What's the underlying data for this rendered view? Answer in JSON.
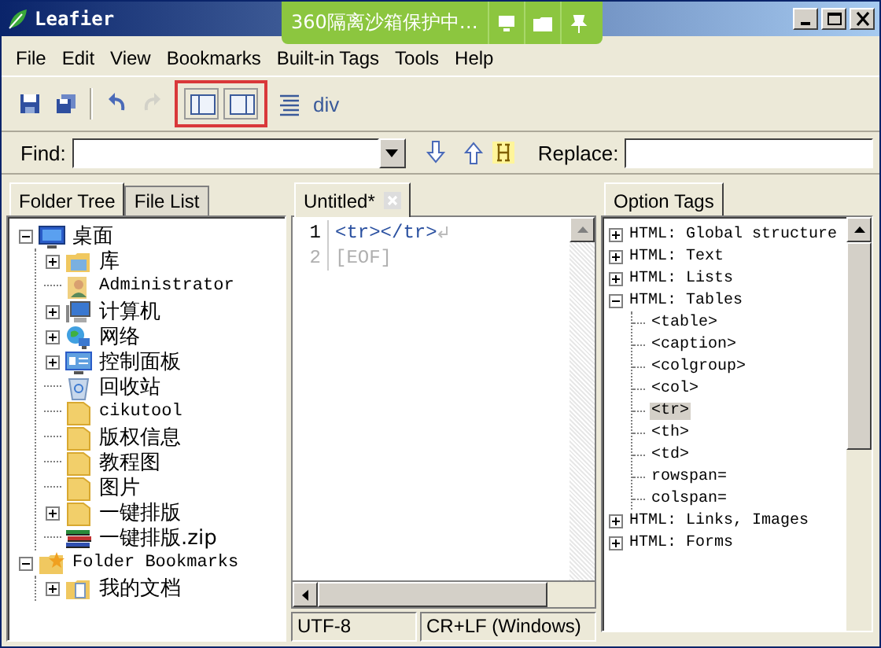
{
  "window": {
    "title": "Leafier"
  },
  "sandbox_bar": {
    "text": "360隔离沙箱保护中…"
  },
  "menu": [
    "File",
    "Edit",
    "View",
    "Bookmarks",
    "Built-in Tags",
    "Tools",
    "Help"
  ],
  "toolbar": {
    "groups": [
      {
        "highlighted": false,
        "buttons": [
          {
            "kind": "save",
            "disabled": false
          },
          {
            "kind": "save-all",
            "disabled": false
          }
        ]
      },
      {
        "highlighted": false,
        "buttons": [
          {
            "kind": "undo",
            "disabled": false
          },
          {
            "kind": "redo",
            "disabled": true
          }
        ]
      },
      {
        "highlighted": true,
        "buttons": [
          {
            "kind": "left-pane",
            "disabled": false
          },
          {
            "kind": "right-pane",
            "disabled": false
          }
        ]
      },
      {
        "highlighted": false,
        "buttons": [
          {
            "kind": "align",
            "disabled": false
          }
        ]
      }
    ],
    "tag_label": "div"
  },
  "find_bar": {
    "find_label": "Find:",
    "replace_label": "Replace:"
  },
  "left_panel": {
    "tabs": [
      {
        "label": "Folder Tree",
        "selected": true
      },
      {
        "label": "File List",
        "selected": false
      }
    ],
    "tree": [
      {
        "label": "桌面",
        "kind": "desktop",
        "expanded": true,
        "children": [
          {
            "label": "库",
            "kind": "library",
            "expanded": false
          },
          {
            "label": "Administrator",
            "kind": "user"
          },
          {
            "label": "计算机",
            "kind": "computer",
            "expanded": false
          },
          {
            "label": "网络",
            "kind": "network",
            "expanded": false
          },
          {
            "label": "控制面板",
            "kind": "control-panel",
            "expanded": false
          },
          {
            "label": "回收站",
            "kind": "recycle-bin"
          },
          {
            "label": "cikutool",
            "kind": "folder"
          },
          {
            "label": "版权信息",
            "kind": "folder"
          },
          {
            "label": "教程图",
            "kind": "folder"
          },
          {
            "label": "图片",
            "kind": "folder"
          },
          {
            "label": "一键排版",
            "kind": "folder",
            "expanded": false
          },
          {
            "label": "一键排版.zip",
            "kind": "archive"
          }
        ]
      },
      {
        "label": "Folder Bookmarks",
        "kind": "bookmarks",
        "expanded": true,
        "children": [
          {
            "label": "我的文档",
            "kind": "documents",
            "expanded": false
          }
        ]
      }
    ]
  },
  "editor": {
    "tabs": [
      {
        "label": "Untitled*",
        "selected": true
      }
    ],
    "lines": [
      {
        "number": "1",
        "text": "<tr></tr>",
        "kind": "code"
      },
      {
        "number": "2",
        "text": "[EOF]",
        "kind": "eof"
      }
    ],
    "status": {
      "encoding": "UTF-8",
      "line_ending": "CR+LF (Windows)"
    }
  },
  "right_panel": {
    "tabs": [
      {
        "label": "Option Tags",
        "selected": true
      }
    ],
    "tree": [
      {
        "label": "HTML: Global structure",
        "expanded": false
      },
      {
        "label": "HTML: Text",
        "expanded": false
      },
      {
        "label": "HTML: Lists",
        "expanded": false
      },
      {
        "label": "HTML: Tables",
        "expanded": true,
        "children": [
          {
            "label": "<table>",
            "selected": false
          },
          {
            "label": "<caption>",
            "selected": false
          },
          {
            "label": "<colgroup>",
            "selected": false
          },
          {
            "label": "<col>",
            "selected": false
          },
          {
            "label": "<tr>",
            "selected": true
          },
          {
            "label": "<th>",
            "selected": false
          },
          {
            "label": "<td>",
            "selected": false
          },
          {
            "label": "rowspan=",
            "selected": false
          },
          {
            "label": "colspan=",
            "selected": false
          }
        ]
      },
      {
        "label": "HTML: Links, Images",
        "expanded": false
      },
      {
        "label": "HTML: Forms",
        "expanded": false
      }
    ]
  }
}
